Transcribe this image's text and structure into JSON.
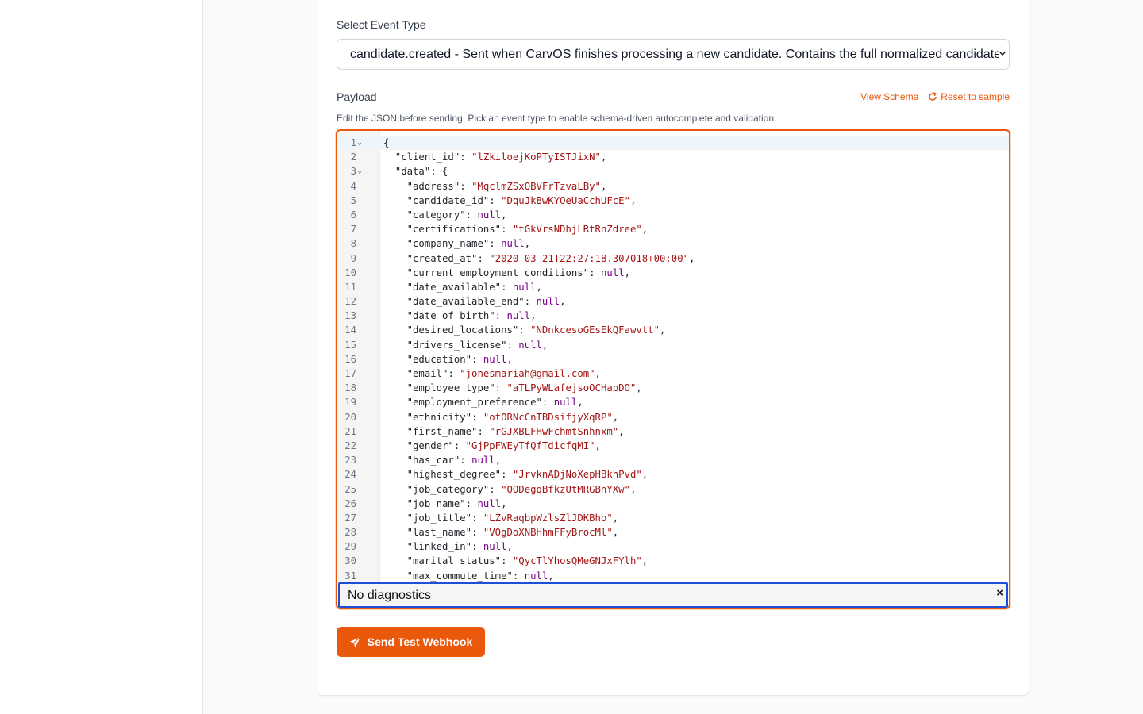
{
  "form": {
    "event_type_label": "Select Event Type",
    "event_type_value": "candidate.created - Sent when CarvOS finishes processing a new candidate. Contains the full normalized candidate record.",
    "payload_label": "Payload",
    "view_schema": "View Schema",
    "reset_sample": "Reset to sample",
    "help_text": "Edit the JSON before sending. Pick an event type to enable schema-driven autocomplete and validation.",
    "diagnostics": "No diagnostics",
    "diagnostics_close": "×",
    "send_button": "Send Test Webhook"
  },
  "editor": {
    "lines": [
      {
        "n": "1",
        "fold": true,
        "parts": [
          {
            "t": "{",
            "c": "p"
          }
        ]
      },
      {
        "n": "2",
        "parts": [
          {
            "t": "  \"client_id\"",
            "c": "k"
          },
          {
            "t": ": ",
            "c": "p"
          },
          {
            "t": "\"lZkiloejKoPTyISTJixN\"",
            "c": "s"
          },
          {
            "t": ",",
            "c": "p"
          }
        ]
      },
      {
        "n": "3",
        "fold": true,
        "parts": [
          {
            "t": "  \"data\"",
            "c": "k"
          },
          {
            "t": ": {",
            "c": "p"
          }
        ]
      },
      {
        "n": "4",
        "parts": [
          {
            "t": "    \"address\"",
            "c": "k"
          },
          {
            "t": ": ",
            "c": "p"
          },
          {
            "t": "\"MqclmZSxQBVFrTzvaLBy\"",
            "c": "s"
          },
          {
            "t": ",",
            "c": "p"
          }
        ]
      },
      {
        "n": "5",
        "parts": [
          {
            "t": "    \"candidate_id\"",
            "c": "k"
          },
          {
            "t": ": ",
            "c": "p"
          },
          {
            "t": "\"DquJkBwKYOeUaCchUFcE\"",
            "c": "s"
          },
          {
            "t": ",",
            "c": "p"
          }
        ]
      },
      {
        "n": "6",
        "parts": [
          {
            "t": "    \"category\"",
            "c": "k"
          },
          {
            "t": ": ",
            "c": "p"
          },
          {
            "t": "null",
            "c": "n"
          },
          {
            "t": ",",
            "c": "p"
          }
        ]
      },
      {
        "n": "7",
        "parts": [
          {
            "t": "    \"certifications\"",
            "c": "k"
          },
          {
            "t": ": ",
            "c": "p"
          },
          {
            "t": "\"tGkVrsNDhjLRtRnZdree\"",
            "c": "s"
          },
          {
            "t": ",",
            "c": "p"
          }
        ]
      },
      {
        "n": "8",
        "parts": [
          {
            "t": "    \"company_name\"",
            "c": "k"
          },
          {
            "t": ": ",
            "c": "p"
          },
          {
            "t": "null",
            "c": "n"
          },
          {
            "t": ",",
            "c": "p"
          }
        ]
      },
      {
        "n": "9",
        "parts": [
          {
            "t": "    \"created_at\"",
            "c": "k"
          },
          {
            "t": ": ",
            "c": "p"
          },
          {
            "t": "\"2020-03-21T22:27:18.307018+00:00\"",
            "c": "s"
          },
          {
            "t": ",",
            "c": "p"
          }
        ]
      },
      {
        "n": "10",
        "parts": [
          {
            "t": "    \"current_employment_conditions\"",
            "c": "k"
          },
          {
            "t": ": ",
            "c": "p"
          },
          {
            "t": "null",
            "c": "n"
          },
          {
            "t": ",",
            "c": "p"
          }
        ]
      },
      {
        "n": "11",
        "parts": [
          {
            "t": "    \"date_available\"",
            "c": "k"
          },
          {
            "t": ": ",
            "c": "p"
          },
          {
            "t": "null",
            "c": "n"
          },
          {
            "t": ",",
            "c": "p"
          }
        ]
      },
      {
        "n": "12",
        "parts": [
          {
            "t": "    \"date_available_end\"",
            "c": "k"
          },
          {
            "t": ": ",
            "c": "p"
          },
          {
            "t": "null",
            "c": "n"
          },
          {
            "t": ",",
            "c": "p"
          }
        ]
      },
      {
        "n": "13",
        "parts": [
          {
            "t": "    \"date_of_birth\"",
            "c": "k"
          },
          {
            "t": ": ",
            "c": "p"
          },
          {
            "t": "null",
            "c": "n"
          },
          {
            "t": ",",
            "c": "p"
          }
        ]
      },
      {
        "n": "14",
        "parts": [
          {
            "t": "    \"desired_locations\"",
            "c": "k"
          },
          {
            "t": ": ",
            "c": "p"
          },
          {
            "t": "\"NDnkcesoGEsEkQFawvtt\"",
            "c": "s"
          },
          {
            "t": ",",
            "c": "p"
          }
        ]
      },
      {
        "n": "15",
        "parts": [
          {
            "t": "    \"drivers_license\"",
            "c": "k"
          },
          {
            "t": ": ",
            "c": "p"
          },
          {
            "t": "null",
            "c": "n"
          },
          {
            "t": ",",
            "c": "p"
          }
        ]
      },
      {
        "n": "16",
        "parts": [
          {
            "t": "    \"education\"",
            "c": "k"
          },
          {
            "t": ": ",
            "c": "p"
          },
          {
            "t": "null",
            "c": "n"
          },
          {
            "t": ",",
            "c": "p"
          }
        ]
      },
      {
        "n": "17",
        "parts": [
          {
            "t": "    \"email\"",
            "c": "k"
          },
          {
            "t": ": ",
            "c": "p"
          },
          {
            "t": "\"jonesmariah@gmail.com\"",
            "c": "s"
          },
          {
            "t": ",",
            "c": "p"
          }
        ]
      },
      {
        "n": "18",
        "parts": [
          {
            "t": "    \"employee_type\"",
            "c": "k"
          },
          {
            "t": ": ",
            "c": "p"
          },
          {
            "t": "\"aTLPyWLafejsoOCHapDO\"",
            "c": "s"
          },
          {
            "t": ",",
            "c": "p"
          }
        ]
      },
      {
        "n": "19",
        "parts": [
          {
            "t": "    \"employment_preference\"",
            "c": "k"
          },
          {
            "t": ": ",
            "c": "p"
          },
          {
            "t": "null",
            "c": "n"
          },
          {
            "t": ",",
            "c": "p"
          }
        ]
      },
      {
        "n": "20",
        "parts": [
          {
            "t": "    \"ethnicity\"",
            "c": "k"
          },
          {
            "t": ": ",
            "c": "p"
          },
          {
            "t": "\"otORNcCnTBDsifjyXqRP\"",
            "c": "s"
          },
          {
            "t": ",",
            "c": "p"
          }
        ]
      },
      {
        "n": "21",
        "parts": [
          {
            "t": "    \"first_name\"",
            "c": "k"
          },
          {
            "t": ": ",
            "c": "p"
          },
          {
            "t": "\"rGJXBLFHwFchmtSnhnxm\"",
            "c": "s"
          },
          {
            "t": ",",
            "c": "p"
          }
        ]
      },
      {
        "n": "22",
        "parts": [
          {
            "t": "    \"gender\"",
            "c": "k"
          },
          {
            "t": ": ",
            "c": "p"
          },
          {
            "t": "\"GjPpFWEyTfQfTdicfqMI\"",
            "c": "s"
          },
          {
            "t": ",",
            "c": "p"
          }
        ]
      },
      {
        "n": "23",
        "parts": [
          {
            "t": "    \"has_car\"",
            "c": "k"
          },
          {
            "t": ": ",
            "c": "p"
          },
          {
            "t": "null",
            "c": "n"
          },
          {
            "t": ",",
            "c": "p"
          }
        ]
      },
      {
        "n": "24",
        "parts": [
          {
            "t": "    \"highest_degree\"",
            "c": "k"
          },
          {
            "t": ": ",
            "c": "p"
          },
          {
            "t": "\"JrvknADjNoXepHBkhPvd\"",
            "c": "s"
          },
          {
            "t": ",",
            "c": "p"
          }
        ]
      },
      {
        "n": "25",
        "parts": [
          {
            "t": "    \"job_category\"",
            "c": "k"
          },
          {
            "t": ": ",
            "c": "p"
          },
          {
            "t": "\"QODegqBfkzUtMRGBnYXw\"",
            "c": "s"
          },
          {
            "t": ",",
            "c": "p"
          }
        ]
      },
      {
        "n": "26",
        "parts": [
          {
            "t": "    \"job_name\"",
            "c": "k"
          },
          {
            "t": ": ",
            "c": "p"
          },
          {
            "t": "null",
            "c": "n"
          },
          {
            "t": ",",
            "c": "p"
          }
        ]
      },
      {
        "n": "27",
        "parts": [
          {
            "t": "    \"job_title\"",
            "c": "k"
          },
          {
            "t": ": ",
            "c": "p"
          },
          {
            "t": "\"LZvRaqbpWzlsZlJDKBho\"",
            "c": "s"
          },
          {
            "t": ",",
            "c": "p"
          }
        ]
      },
      {
        "n": "28",
        "parts": [
          {
            "t": "    \"last_name\"",
            "c": "k"
          },
          {
            "t": ": ",
            "c": "p"
          },
          {
            "t": "\"VOgDoXNBHhmFFyBrocMl\"",
            "c": "s"
          },
          {
            "t": ",",
            "c": "p"
          }
        ]
      },
      {
        "n": "29",
        "parts": [
          {
            "t": "    \"linked_in\"",
            "c": "k"
          },
          {
            "t": ": ",
            "c": "p"
          },
          {
            "t": "null",
            "c": "n"
          },
          {
            "t": ",",
            "c": "p"
          }
        ]
      },
      {
        "n": "30",
        "parts": [
          {
            "t": "    \"marital_status\"",
            "c": "k"
          },
          {
            "t": ": ",
            "c": "p"
          },
          {
            "t": "\"QycTlYhosQMeGNJxFYlh\"",
            "c": "s"
          },
          {
            "t": ",",
            "c": "p"
          }
        ]
      },
      {
        "n": "31",
        "parts": [
          {
            "t": "    \"max_commute_time\"",
            "c": "k"
          },
          {
            "t": ": ",
            "c": "p"
          },
          {
            "t": "null",
            "c": "n"
          },
          {
            "t": ",",
            "c": "p"
          }
        ]
      }
    ]
  },
  "colors": {
    "accent": "#ea580c",
    "string": "#a31515",
    "null": "#770088",
    "focus": "#1d4ed8"
  }
}
